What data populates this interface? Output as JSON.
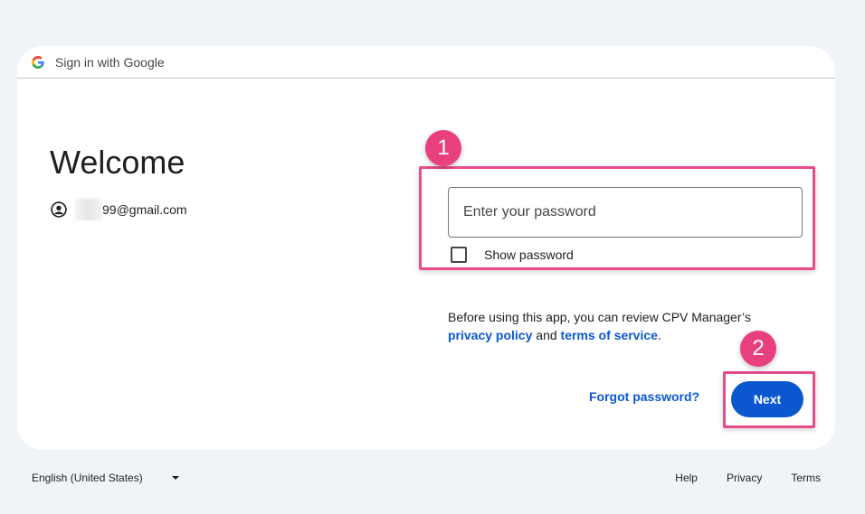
{
  "header": {
    "title": "Sign in with Google",
    "logo_icon": "google-g-icon"
  },
  "welcome": {
    "heading": "Welcome",
    "account_email_suffix": "99@gmail.com",
    "account_icon": "account-circle-icon"
  },
  "password": {
    "placeholder": "Enter your password",
    "value": "",
    "show_password_label": "Show password",
    "show_password_checked": false
  },
  "annotations": {
    "step1": "1",
    "step2": "2",
    "highlight_color": "#e84a8a"
  },
  "notice": {
    "text_before": "Before using this app, you can review CPV Manager’s ",
    "privacy_link": "privacy policy",
    "and": " and ",
    "terms_link": "terms of service",
    "period": "."
  },
  "actions": {
    "forgot_password": "Forgot password?",
    "next": "Next"
  },
  "footer": {
    "language": "English (United States)",
    "help": "Help",
    "privacy": "Privacy",
    "terms": "Terms"
  },
  "colors": {
    "background": "#f0f4f9",
    "primary": "#0b57d0"
  }
}
